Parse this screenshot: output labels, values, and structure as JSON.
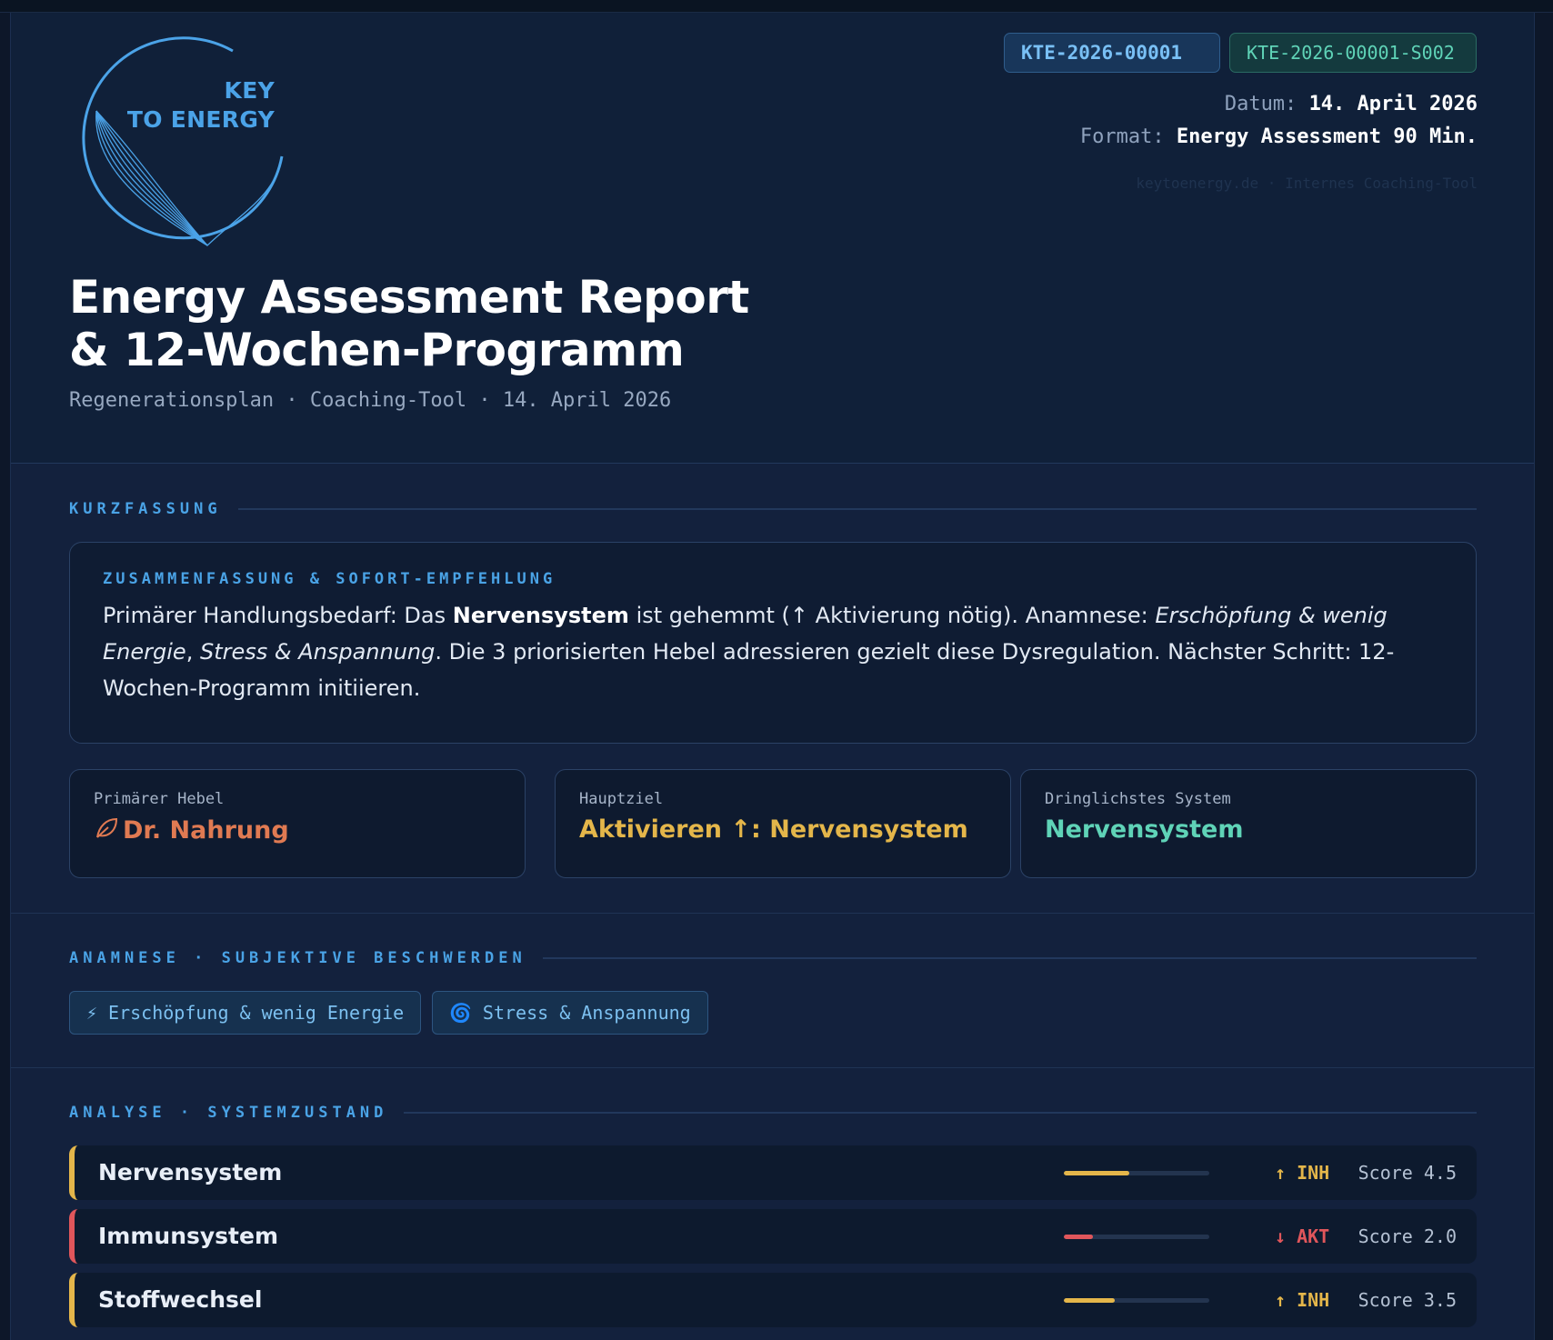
{
  "brand": {
    "logo_line1": "KEY",
    "logo_line2": "TO ENERGY"
  },
  "ids": {
    "client_id": "KTE-2026-00001",
    "session_id": "KTE-2026-00001-S002"
  },
  "meta": {
    "date_label": "Datum:",
    "date_value": "14. April 2026",
    "format_label": "Format:",
    "format_value": "Energy Assessment 90 Min.",
    "footer": "keytoenergy.de · Internes Coaching-Tool"
  },
  "report": {
    "title_line1": "Energy Assessment Report",
    "title_line2": "& 12-Wochen-Programm",
    "subtitle": "Regenerationsplan · Coaching-Tool · 14. April 2026"
  },
  "kurzfassung": {
    "section_title": "KURZFASSUNG",
    "card_title": "ZUSAMMENFASSUNG & SOFORT-EMPFEHLUNG",
    "text_1": "Primärer Handlungsbedarf: Das ",
    "text_bold": "Nervensystem",
    "text_2": " ist gehemmt (↑ Aktivierung nötig). Anamnese: ",
    "text_italic_1": "Erschöpfung & wenig Energie",
    "text_3": ", ",
    "text_italic_2": "Stress & Anspannung",
    "text_4": ". Die 3 priorisierten Hebel adressieren gezielt diese Dysregulation. Nächster Schritt: 12-Wochen-Programm initiieren."
  },
  "stats": [
    {
      "label": "Primärer Hebel",
      "value": "Dr. Nahrung",
      "icon": "leaf-icon",
      "color": "#e07a52"
    },
    {
      "label": "Hauptziel",
      "value": "Aktivieren ↑: Nervensystem",
      "color": "#e4b64a"
    },
    {
      "label": "Dringlichstes System",
      "value": "Nervensystem",
      "color": "#5fd3b7"
    }
  ],
  "anamnese": {
    "section_title": "ANAMNESE · SUBJEKTIVE BESCHWERDEN",
    "chips": [
      {
        "icon": "⚡",
        "icon_name": "lightning-icon",
        "label": "Erschöpfung & wenig Energie"
      },
      {
        "icon": "🌀",
        "icon_name": "spiral-icon",
        "label": "Stress & Anspannung"
      }
    ]
  },
  "analyse": {
    "section_title": "ANALYSE · SYSTEMZUSTAND",
    "systems": [
      {
        "name": "Nervensystem",
        "status": "↑ INH",
        "score": "Score 4.5",
        "level": 0.45,
        "color": "#e4b64a"
      },
      {
        "name": "Immunsystem",
        "status": "↓ AKT",
        "score": "Score 2.0",
        "level": 0.2,
        "color": "#e0565b"
      },
      {
        "name": "Stoffwechsel",
        "status": "↑ INH",
        "score": "Score 3.5",
        "level": 0.35,
        "color": "#e4b64a"
      }
    ]
  },
  "colors": {
    "accent": "#4aa3e6",
    "inhibited": "#e4b64a",
    "activated": "#e0565b"
  }
}
